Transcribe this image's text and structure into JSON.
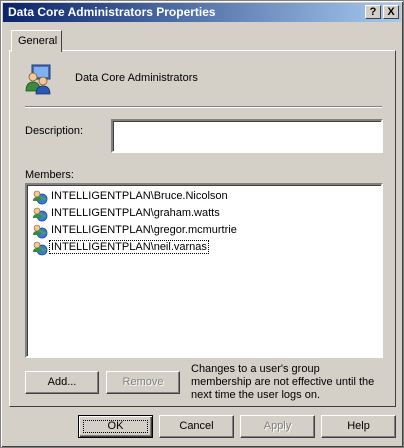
{
  "window": {
    "title": "Data Core Administrators Properties",
    "help_glyph": "?",
    "close_glyph": "X"
  },
  "tabs": [
    {
      "label": "General",
      "selected": true
    }
  ],
  "general": {
    "group_icon": "group-users-icon",
    "group_name": "Data Core Administrators",
    "description_label": "Description:",
    "description_value": "",
    "members_label": "Members:",
    "members": [
      {
        "name": "INTELLIGENTPLAN\\Bruce.Nicolson",
        "icon": "user-globe-icon"
      },
      {
        "name": "INTELLIGENTPLAN\\graham.watts",
        "icon": "user-globe-icon"
      },
      {
        "name": "INTELLIGENTPLAN\\gregor.mcmurtrie",
        "icon": "user-globe-icon"
      },
      {
        "name": "INTELLIGENTPLAN\\neil.varnas",
        "icon": "user-globe-icon",
        "focused": true
      }
    ],
    "add_label": "Add...",
    "remove_label": "Remove",
    "remove_enabled": false,
    "note": "Changes to a user's group membership are not effective until the next time the user logs on."
  },
  "footer": {
    "ok_label": "OK",
    "cancel_label": "Cancel",
    "apply_label": "Apply",
    "apply_enabled": false,
    "help_label": "Help"
  },
  "colors": {
    "titlebar_start": "#0a246a",
    "titlebar_end": "#a6caf0",
    "face": "#d4d0c8"
  }
}
